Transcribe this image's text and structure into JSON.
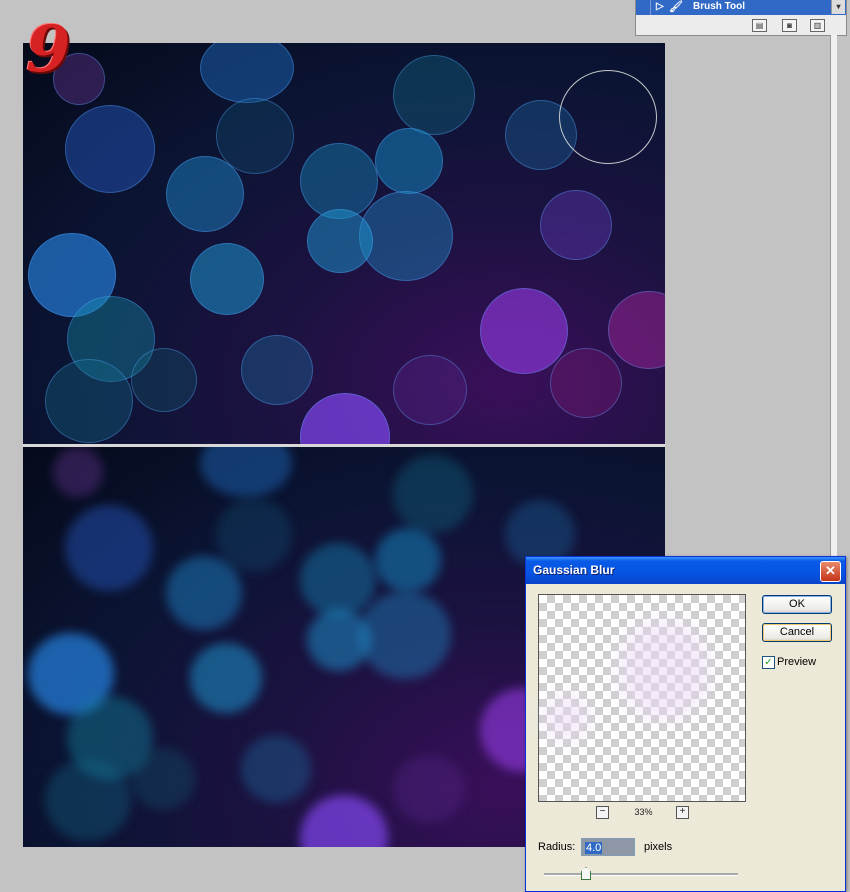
{
  "step_number": "9",
  "history_panel": {
    "active_state_label": "Brush Tool",
    "scroll_glyph": "▾",
    "icons": [
      "new-document-icon",
      "snapshot-icon",
      "trash-icon"
    ]
  },
  "gaussian_blur": {
    "title": "Gaussian Blur",
    "close_glyph": "✕",
    "ok_label": "OK",
    "cancel_label": "Cancel",
    "preview_label": "Preview",
    "preview_checked": true,
    "check_glyph": "✓",
    "zoom_out_glyph": "−",
    "zoom_in_glyph": "+",
    "zoom_level": "33%",
    "radius_label": "Radius:",
    "radius_value": "4.0",
    "radius_units": "pixels"
  },
  "colors": {
    "accent_titlebar": "#0554e3",
    "history_selected": "#3169c6",
    "step_badge": "#d62222"
  }
}
